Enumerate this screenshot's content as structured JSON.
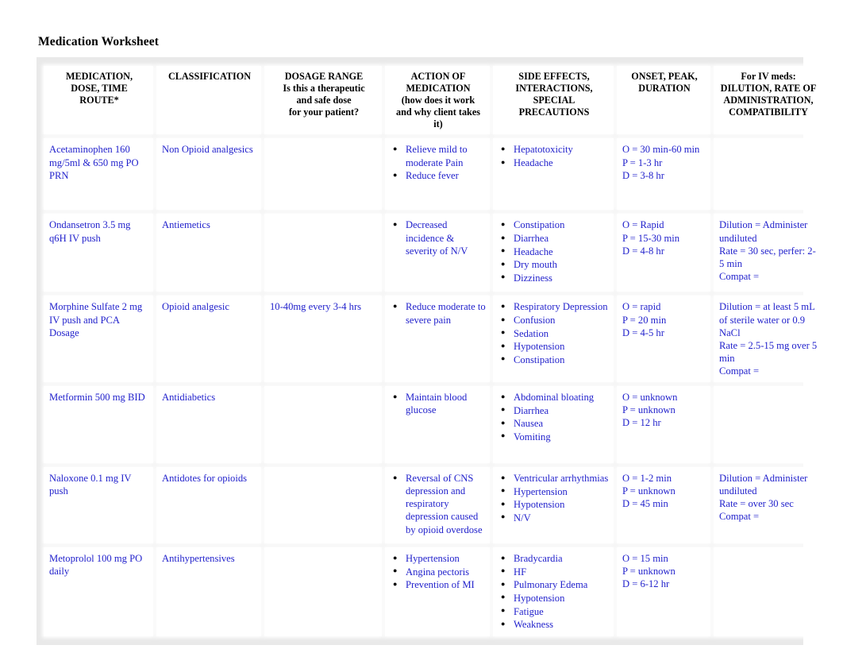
{
  "document": {
    "title": "Medication Worksheet"
  },
  "colors": {
    "body_text": "#2222cc",
    "header_text": "#000000",
    "bullet": "#000000",
    "cell_background": "#ffffff",
    "grid_background": "#e9e9e9"
  },
  "table": {
    "headers": [
      {
        "line1": "MEDICATION,",
        "line2": "DOSE, TIME",
        "line3": "ROUTE*"
      },
      {
        "line1": "CLASSIFICATION"
      },
      {
        "line1": "DOSAGE RANGE",
        "line2": "Is this a therapeutic",
        "line3": "and safe dose",
        "line4": "for your patient?"
      },
      {
        "line1": "ACTION OF",
        "line2": "MEDICATION",
        "line3": "(how does it work",
        "line4": "and why client takes",
        "line5": "it)"
      },
      {
        "line1": "SIDE EFFECTS,",
        "line2": "INTERACTIONS,",
        "line3": "SPECIAL",
        "line4": "PRECAUTIONS"
      },
      {
        "line1": "ONSET, PEAK,",
        "line2": "DURATION"
      },
      {
        "line1": "For IV meds:",
        "line2": "DILUTION, RATE OF",
        "line3": "ADMINISTRATION,",
        "line4": "COMPATIBILITY"
      }
    ],
    "rows": [
      {
        "medication": "Acetaminophen 160 mg/5ml  & 650 mg PO PRN",
        "classification": "Non Opioid analgesics",
        "dosage_range": "",
        "action": [
          "Relieve mild to moderate Pain",
          "Reduce fever"
        ],
        "side_effects": [
          "Hepatotoxicity",
          "Headache"
        ],
        "onset_peak_duration": "O = 30 min-60 min\nP = 1-3 hr\nD = 3-8 hr",
        "iv_info": ""
      },
      {
        "medication": "Ondansetron 3.5 mg q6H IV push",
        "classification": "Antiemetics",
        "dosage_range": "",
        "action": [
          "Decreased incidence & severity of N/V"
        ],
        "side_effects": [
          "Constipation",
          "Diarrhea",
          "Headache",
          "Dry mouth",
          "Dizziness"
        ],
        "onset_peak_duration": "O = Rapid\nP = 15-30 min\nD = 4-8  hr",
        "iv_info": "Dilution = Administer undiluted\nRate = 30 sec,  perfer: 2-5 min\nCompat ="
      },
      {
        "medication": "Morphine Sulfate 2 mg IV push and PCA Dosage",
        "classification": "Opioid analgesic",
        "dosage_range": "10-40mg  every 3-4 hrs",
        "action": [
          "Reduce  moderate to severe  pain"
        ],
        "side_effects": [
          "Respiratory Depression",
          "Confusion",
          "Sedation",
          "Hypotension",
          "Constipation"
        ],
        "onset_peak_duration": "O = rapid\nP = 20 min\nD = 4-5 hr",
        "iv_info": "Dilution = at least  5 mL of  sterile water  or 0.9 NaCl\nRate = 2.5-15 mg  over 5 min\nCompat ="
      },
      {
        "medication": "Metformin 500 mg BID",
        "classification": "Antidiabetics",
        "dosage_range": "",
        "action": [
          "Maintain  blood glucose"
        ],
        "side_effects": [
          "Abdominal bloating",
          "Diarrhea",
          "Nausea",
          "Vomiting"
        ],
        "onset_peak_duration": "O = unknown\nP = unknown\nD = 12 hr",
        "iv_info": ""
      },
      {
        "medication": "Naloxone 0.1 mg IV push",
        "classification": "Antidotes for  opioids",
        "dosage_range": "",
        "action": [
          "Reversal of CNS depression and respiratory depression  caused by opioid overdose"
        ],
        "side_effects": [
          "Ventricular arrhythmias",
          "Hypertension",
          "Hypotension",
          "N/V"
        ],
        "onset_peak_duration": "O = 1-2 min\nP = unknown\nD = 45 min",
        "iv_info": "Dilution = Administer undiluted\nRate = over 30 sec\nCompat ="
      },
      {
        "medication": "Metoprolol 100  mg PO daily",
        "classification": "Antihypertensives",
        "dosage_range": "",
        "action": [
          "Hypertension",
          "Angina pectoris",
          "Prevention  of MI"
        ],
        "side_effects": [
          "Bradycardia",
          "HF",
          "Pulmonary  Edema",
          "Hypotension",
          "Fatigue",
          "Weakness"
        ],
        "onset_peak_duration": "O = 15  min\nP = unknown\nD = 6-12 hr",
        "iv_info": ""
      }
    ]
  }
}
